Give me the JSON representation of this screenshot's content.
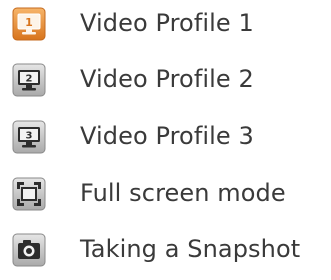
{
  "items": [
    {
      "label": "Video Profile 1",
      "icon": "monitor-1-icon",
      "active": true
    },
    {
      "label": "Video Profile 2",
      "icon": "monitor-2-icon",
      "active": false
    },
    {
      "label": "Video Profile 3",
      "icon": "monitor-3-icon",
      "active": false
    },
    {
      "label": "Full screen mode",
      "icon": "fullscreen-icon",
      "active": false
    },
    {
      "label": "Taking a Snapshot",
      "icon": "camera-icon",
      "active": false
    }
  ],
  "colors": {
    "text": "#3a3a3a",
    "active_icon": "#e8872a",
    "inactive_icon": "#b9b9b9"
  }
}
